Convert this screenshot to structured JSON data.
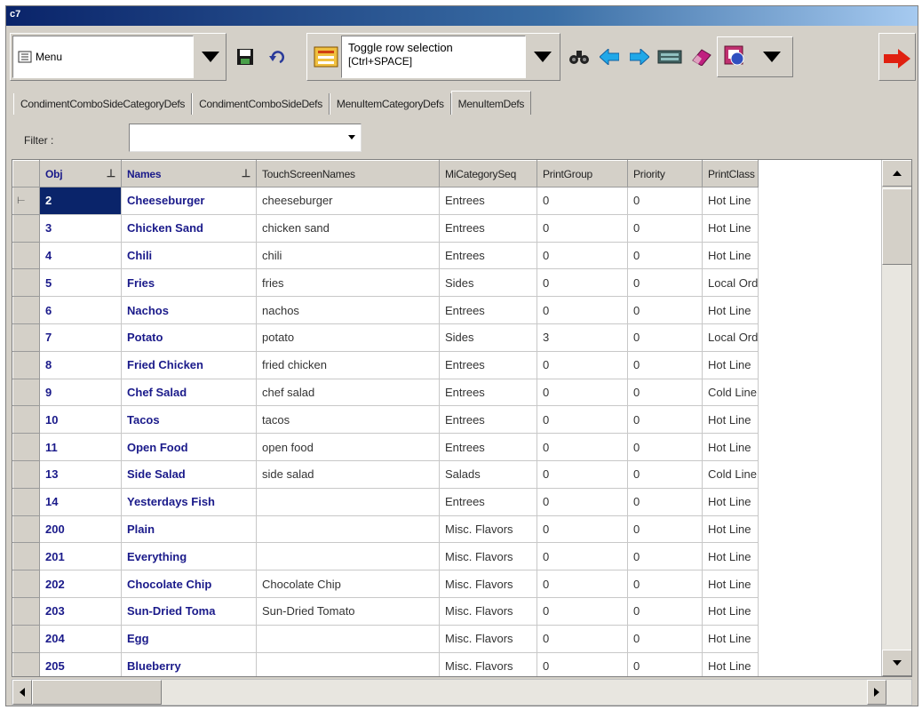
{
  "window": {
    "title": "c7"
  },
  "toolbar": {
    "menu_label": "Menu",
    "toggle_label_line1": "Toggle row selection",
    "toggle_label_line2": "[Ctrl+SPACE]"
  },
  "tabs": [
    {
      "label": "CondimentComboSideCategoryDefs",
      "active": false
    },
    {
      "label": "CondimentComboSideDefs",
      "active": false
    },
    {
      "label": "MenuItemCategoryDefs",
      "active": false
    },
    {
      "label": "MenuItemDefs",
      "active": true
    }
  ],
  "filter": {
    "label": "Filter :",
    "value": ""
  },
  "grid": {
    "columns": [
      "Obj",
      "Names",
      "TouchScreenNames",
      "MiCategorySeq",
      "PrintGroup",
      "Priority",
      "PrintClass"
    ],
    "rows": [
      {
        "obj": "2",
        "name": "Cheeseburger",
        "touch": "cheeseburger",
        "cat": "Entrees",
        "pg": "0",
        "pri": "0",
        "pc": "Hot Line"
      },
      {
        "obj": "3",
        "name": "Chicken Sand",
        "touch": "chicken sand",
        "cat": "Entrees",
        "pg": "0",
        "pri": "0",
        "pc": "Hot Line"
      },
      {
        "obj": "4",
        "name": "Chili",
        "touch": "chili",
        "cat": "Entrees",
        "pg": "0",
        "pri": "0",
        "pc": "Hot Line"
      },
      {
        "obj": "5",
        "name": "Fries",
        "touch": "fries",
        "cat": "Sides",
        "pg": "0",
        "pri": "0",
        "pc": "Local Ord"
      },
      {
        "obj": "6",
        "name": "Nachos",
        "touch": "nachos",
        "cat": "Entrees",
        "pg": "0",
        "pri": "0",
        "pc": "Hot Line"
      },
      {
        "obj": "7",
        "name": "Potato",
        "touch": "potato",
        "cat": "Sides",
        "pg": "3",
        "pri": "0",
        "pc": "Local Ord"
      },
      {
        "obj": "8",
        "name": "Fried Chicken",
        "touch": "fried chicken",
        "cat": "Entrees",
        "pg": "0",
        "pri": "0",
        "pc": "Hot Line"
      },
      {
        "obj": "9",
        "name": "Chef Salad",
        "touch": "chef salad",
        "cat": "Entrees",
        "pg": "0",
        "pri": "0",
        "pc": "Cold Line"
      },
      {
        "obj": "10",
        "name": "Tacos",
        "touch": "tacos",
        "cat": "Entrees",
        "pg": "0",
        "pri": "0",
        "pc": "Hot Line"
      },
      {
        "obj": "11",
        "name": "Open Food",
        "touch": "open food",
        "cat": "Entrees",
        "pg": "0",
        "pri": "0",
        "pc": "Hot Line"
      },
      {
        "obj": "13",
        "name": "Side Salad",
        "touch": "side salad",
        "cat": "Salads",
        "pg": "0",
        "pri": "0",
        "pc": "Cold Line"
      },
      {
        "obj": "14",
        "name": "Yesterdays Fish",
        "touch": "",
        "cat": "Entrees",
        "pg": "0",
        "pri": "0",
        "pc": "Hot Line"
      },
      {
        "obj": "200",
        "name": "Plain",
        "touch": "",
        "cat": "Misc. Flavors",
        "pg": "0",
        "pri": "0",
        "pc": "Hot Line"
      },
      {
        "obj": "201",
        "name": "Everything",
        "touch": "",
        "cat": "Misc. Flavors",
        "pg": "0",
        "pri": "0",
        "pc": "Hot Line"
      },
      {
        "obj": "202",
        "name": "Chocolate Chip",
        "touch": "Chocolate Chip",
        "cat": "Misc. Flavors",
        "pg": "0",
        "pri": "0",
        "pc": "Hot Line"
      },
      {
        "obj": "203",
        "name": "Sun-Dried Toma",
        "touch": "Sun-Dried Tomato",
        "cat": "Misc. Flavors",
        "pg": "0",
        "pri": "0",
        "pc": "Hot Line"
      },
      {
        "obj": "204",
        "name": "Egg",
        "touch": "",
        "cat": "Misc. Flavors",
        "pg": "0",
        "pri": "0",
        "pc": "Hot Line"
      },
      {
        "obj": "205",
        "name": "Blueberry",
        "touch": "",
        "cat": "Misc. Flavors",
        "pg": "0",
        "pri": "0",
        "pc": "Hot Line"
      }
    ],
    "current_row_marker": "⊢"
  },
  "icons": [
    "menu-icon",
    "save-icon",
    "undo-icon",
    "toggle-selection-icon",
    "find-icon",
    "back-icon",
    "forward-icon",
    "keyboard-icon",
    "eraser-icon",
    "reports-icon",
    "exit-icon"
  ],
  "colors": {
    "header_blue": "#1a1a8a",
    "selection": "#0a246a",
    "chrome": "#d4d0c8",
    "exit_arrow": "#e02010"
  }
}
